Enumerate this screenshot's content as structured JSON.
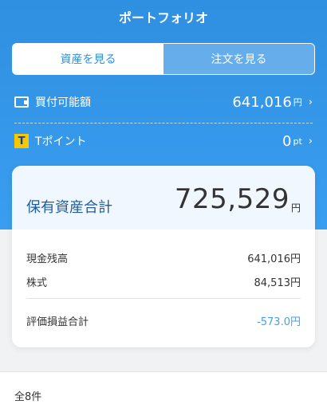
{
  "header": {
    "title": "ポートフォリオ"
  },
  "segment": {
    "assets": "資産を見る",
    "orders": "注文を見る"
  },
  "buying_power": {
    "label": "買付可能額",
    "value": "641,016",
    "unit": "円",
    "chevron": "›"
  },
  "tpoint": {
    "logo": "T",
    "label": "Tポイント",
    "value": "0",
    "unit": "pt",
    "chevron": "›"
  },
  "card": {
    "total_label": "保有資産合計",
    "total_value": "725,529",
    "total_unit": "円",
    "rows": [
      {
        "label": "現金残高",
        "value": "641,016円"
      },
      {
        "label": "株式",
        "value": "84,513円"
      }
    ],
    "pl": {
      "label": "評価損益合計",
      "value": "-573.0円"
    }
  },
  "list": {
    "count": "全8件"
  },
  "colors": {
    "primary": "#2f8fe0",
    "negative": "#4a9ee8",
    "tpoint_yellow": "#f6c800"
  },
  "icons": {
    "wallet": "wallet-icon",
    "tpoint": "tpoint-logo"
  }
}
